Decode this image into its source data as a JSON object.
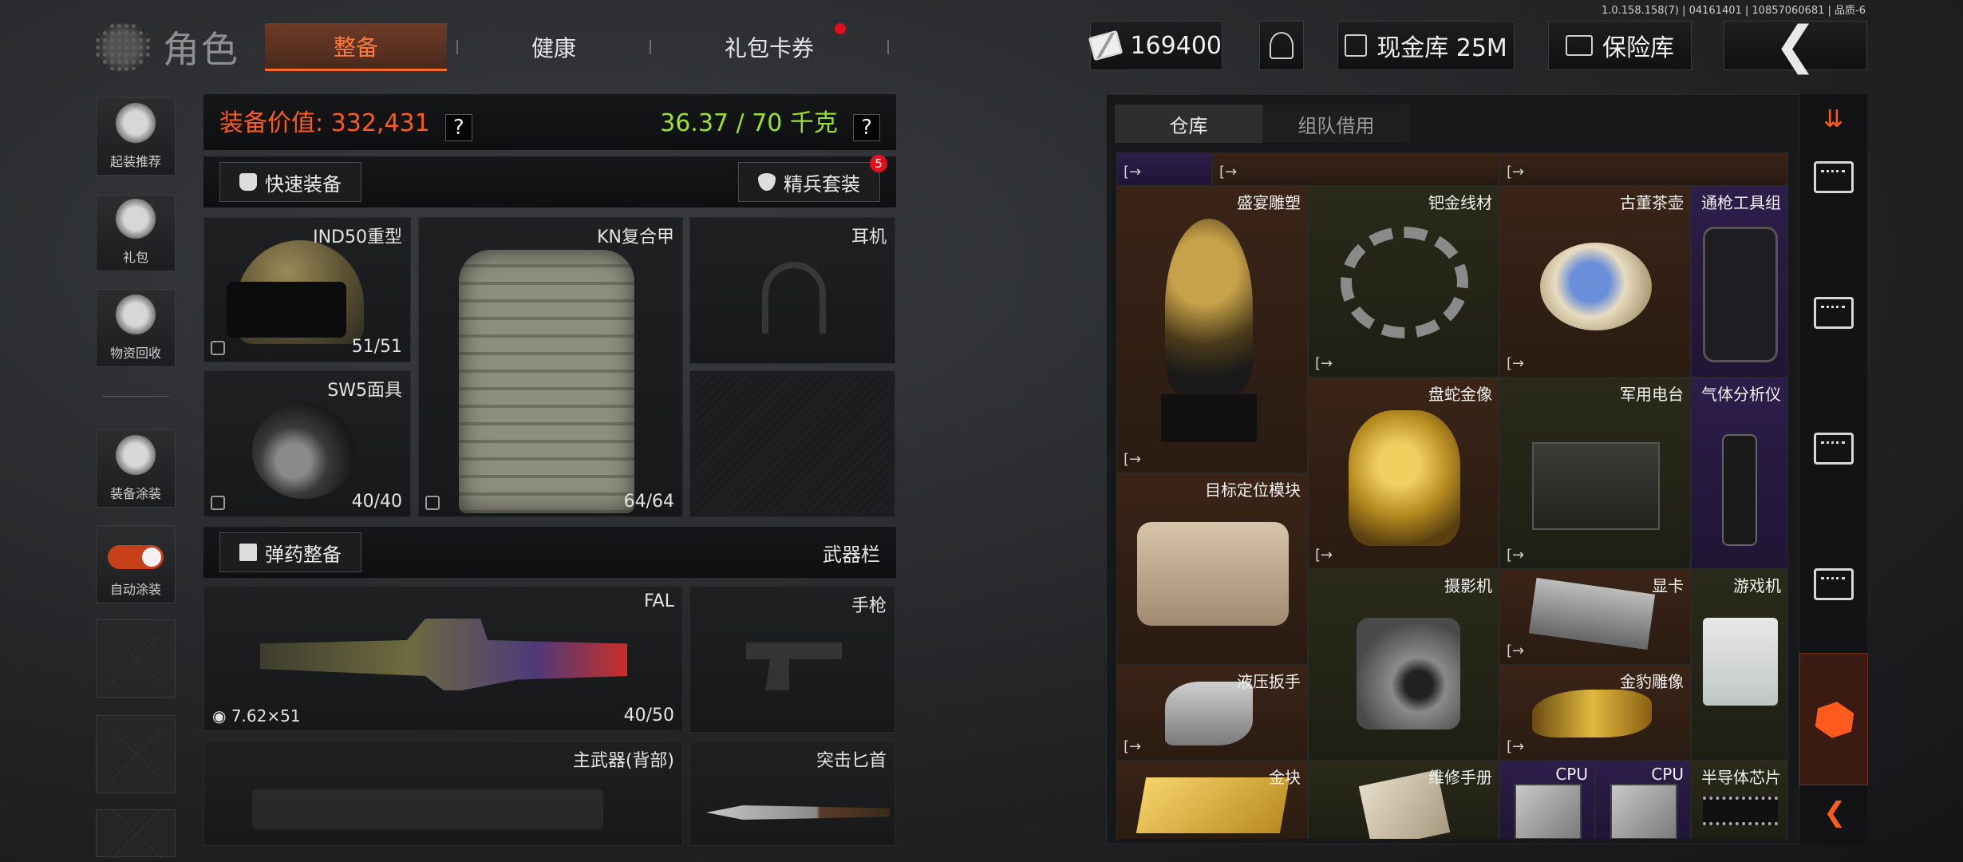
{
  "version": "1.0.158.158(7) | 04161401 | 10857060681 | 品质-6",
  "header": {
    "title": "角色",
    "tabs": [
      {
        "label": "整备",
        "active": true
      },
      {
        "label": "健康",
        "active": false
      },
      {
        "label": "礼包卡券",
        "active": false,
        "dot": true
      }
    ],
    "money": "169400",
    "cash_vault": "现金库 25M",
    "safe": "保险库"
  },
  "sidebar": {
    "items": [
      {
        "label": "起装推荐",
        "icon": "helmet-recommend-icon"
      },
      {
        "label": "礼包",
        "icon": "gift-icon"
      },
      {
        "label": "物资回收",
        "icon": "recycle-icon"
      },
      {
        "label": "装备涂装",
        "icon": "paint-icon"
      },
      {
        "label": "自动涂装",
        "icon": "toggle-icon",
        "toggle_on": true
      }
    ]
  },
  "equipment": {
    "value_label": "装备价值: 332,431",
    "weight_label": "36.37 / 70 千克",
    "quick_equip": "快速装备",
    "elite_set": "精兵套装",
    "elite_badge": "5",
    "slots": {
      "helmet": {
        "name": "IND50重型",
        "durability": "51/51"
      },
      "armor": {
        "name": "KN复合甲",
        "durability": "64/64"
      },
      "headset": {
        "name": "耳机"
      },
      "mask": {
        "name": "SW5面具",
        "durability": "40/40"
      }
    },
    "ammo_button": "弹药整备",
    "weapon_bar": "武器栏",
    "weapons": {
      "primary": {
        "name": "FAL",
        "ammo": "40/50",
        "caliber": "7.62×51"
      },
      "pistol": {
        "name": "手枪"
      },
      "primary_back": {
        "name": "主武器(背部)"
      },
      "melee": {
        "name": "突击匕首"
      }
    }
  },
  "warehouse": {
    "tabs": [
      {
        "label": "仓库",
        "active": true
      },
      {
        "label": "组队借用",
        "active": false
      }
    ],
    "items": [
      {
        "name": "盛宴雕塑",
        "color": "brown"
      },
      {
        "name": "钯金线材",
        "color": "olive"
      },
      {
        "name": "古董茶壶",
        "color": "brown"
      },
      {
        "name": "通枪工具组",
        "color": "purple"
      },
      {
        "name": "盘蛇金像",
        "color": "brown"
      },
      {
        "name": "军用电台",
        "color": "olive"
      },
      {
        "name": "气体分析仪",
        "color": "purple"
      },
      {
        "name": "目标定位模块",
        "color": "brown"
      },
      {
        "name": "摄影机",
        "color": "olive"
      },
      {
        "name": "显卡",
        "color": "brown"
      },
      {
        "name": "游戏机",
        "color": "olive"
      },
      {
        "name": "液压扳手",
        "color": "brown"
      },
      {
        "name": "金豹雕像",
        "color": "brown"
      },
      {
        "name": "金块",
        "color": "brown"
      },
      {
        "name": "维修手册",
        "color": "olive"
      },
      {
        "name": "CPU",
        "color": "purple"
      },
      {
        "name": "CPU",
        "color": "purple"
      },
      {
        "name": "半导体芯片",
        "color": "olive"
      }
    ],
    "exit_glyph": "[→"
  },
  "colors": {
    "accent": "#ff5a1e",
    "weight_green": "#9be22a",
    "badge_red": "#e2101e"
  }
}
